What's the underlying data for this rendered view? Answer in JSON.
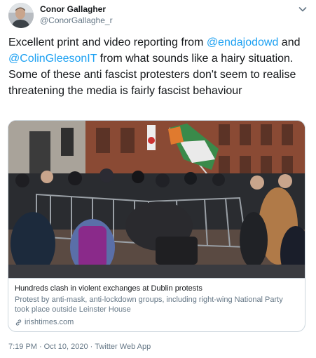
{
  "author": {
    "name": "Conor Gallagher",
    "handle": "@ConorGallaghe_r",
    "avatar_icon": "profile-photo"
  },
  "tweet": {
    "text_before_mention_1": "Excellent print and video reporting from ",
    "mention_1": "@endajodowd",
    "text_between_mentions": " and ",
    "mention_2": "@ColinGleesonIT",
    "text_after_mentions": " from what sounds like a hairy situation. Some of these anti fascist protesters don't seem to realise threatening the media is fairly fascist behaviour"
  },
  "card": {
    "image_icon": "protest-photo",
    "title": "Hundreds clash in violent exchanges at Dublin protests",
    "description": "Protest by anti-mask, anti-lockdown groups, including right-wing National Party took place outside Leinster House",
    "domain": "irishtimes.com",
    "link_icon": "link-icon"
  },
  "meta": {
    "time": "7:19 PM",
    "separator_1": "·",
    "date": "Oct 10, 2020",
    "separator_2": "·",
    "source": "Twitter Web App"
  },
  "colors": {
    "link": "#1da1f2",
    "secondary_text": "#657786",
    "border": "#ccd6dd"
  }
}
